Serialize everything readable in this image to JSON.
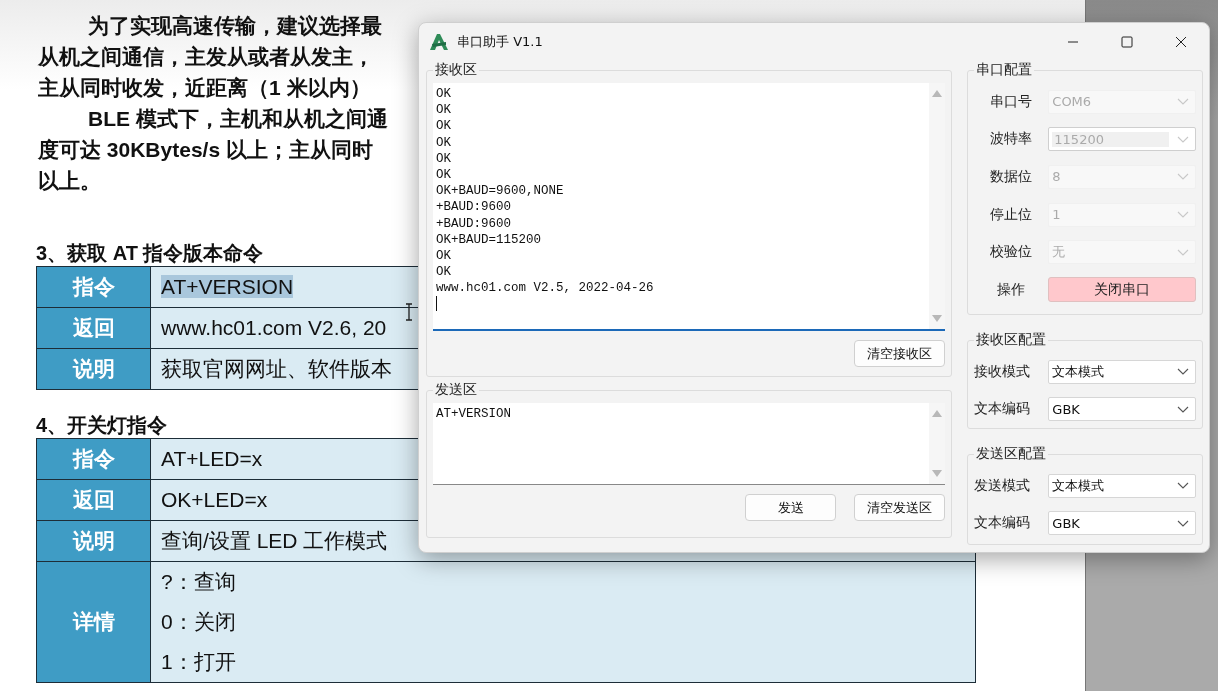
{
  "document": {
    "paragraphs": [
      {
        "lines": [
          "为了实现高速传输，建议选择最",
          "从机之间通信，主发从或者从发主，",
          "主从同时收发，近距离（1 米以内）"
        ]
      },
      {
        "lines": [
          "BLE 模式下，主机和从机之间通",
          "度可达 30KBytes/s 以上；主从同时",
          "以上。"
        ]
      }
    ],
    "sections": [
      {
        "heading": "3、获取 AT  指令版本命令",
        "rows": [
          {
            "label": "指令",
            "lines": [
              "AT+VERSION"
            ],
            "selected": true
          },
          {
            "label": "返回",
            "lines": [
              "www.hc01.com V2.6, 20"
            ],
            "selected": false
          },
          {
            "label": "说明",
            "lines": [
              "获取官网网址、软件版本"
            ],
            "selected": false
          }
        ]
      },
      {
        "heading": "4、开关灯指令",
        "rows": [
          {
            "label": "指令",
            "lines": [
              "AT+LED=x"
            ],
            "selected": false
          },
          {
            "label": "返回",
            "lines": [
              "OK+LED=x"
            ],
            "selected": false
          },
          {
            "label": "说明",
            "lines": [
              "查询/设置 LED 工作模式"
            ],
            "selected": false
          },
          {
            "label": "详情",
            "lines": [
              "?：查询",
              "0：关闭",
              "1：打开"
            ],
            "selected": false
          }
        ]
      }
    ]
  },
  "window": {
    "title": "串口助手 V1.1",
    "receive": {
      "title": "接收区",
      "lines": [
        "OK",
        "OK",
        "OK",
        "OK",
        "OK",
        "OK",
        "OK+BAUD=9600,NONE",
        "+BAUD:9600",
        "+BAUD:9600",
        "OK+BAUD=115200",
        "OK",
        "OK",
        "www.hc01.com V2.5, 2022-04-26"
      ],
      "button": "清空接收区"
    },
    "send": {
      "title": "发送区",
      "value": "AT+VERSION",
      "buttons": [
        "发送",
        "清空发送区"
      ]
    },
    "config_groups": [
      {
        "title": "串口配置",
        "rows": [
          {
            "kind": "combo",
            "label": "串口号",
            "value": "COM6",
            "disabled": true
          },
          {
            "kind": "editable",
            "label": "波特率",
            "value": "115200",
            "disabled": true
          },
          {
            "kind": "combo",
            "label": "数据位",
            "value": "8",
            "disabled": true
          },
          {
            "kind": "combo",
            "label": "停止位",
            "value": "1",
            "disabled": true
          },
          {
            "kind": "combo",
            "label": "校验位",
            "value": "无",
            "disabled": true
          },
          {
            "kind": "button",
            "label": "操作",
            "value": "关闭串口"
          }
        ]
      },
      {
        "title": "接收区配置",
        "rows": [
          {
            "kind": "combo",
            "label": "接收模式",
            "value": "文本模式",
            "disabled": false
          },
          {
            "kind": "combo",
            "label": "文本编码",
            "value": "GBK",
            "disabled": false
          }
        ]
      },
      {
        "title": "发送区配置",
        "rows": [
          {
            "kind": "combo",
            "label": "发送模式",
            "value": "文本模式",
            "disabled": false
          },
          {
            "kind": "combo",
            "label": "文本编码",
            "value": "GBK",
            "disabled": false
          }
        ]
      }
    ]
  }
}
